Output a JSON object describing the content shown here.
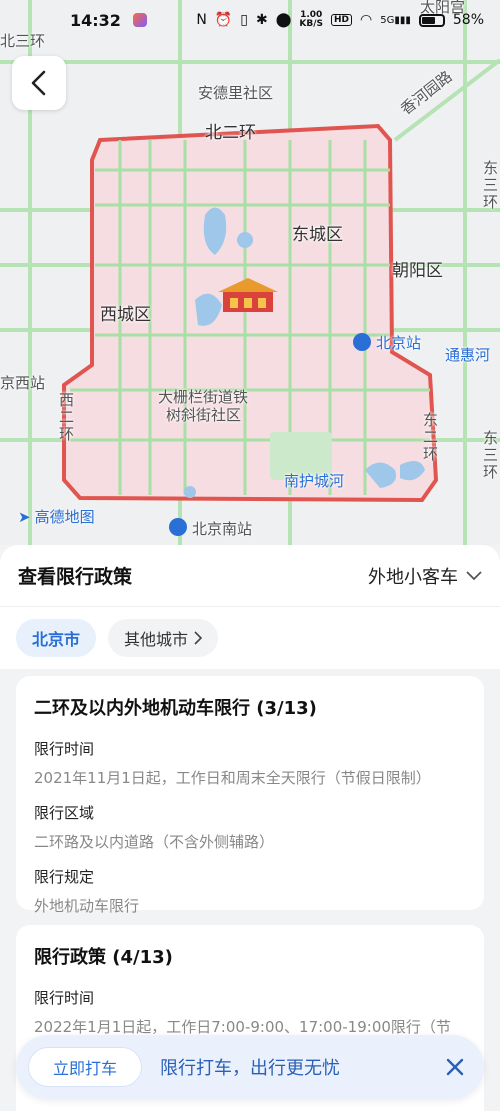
{
  "status_bar": {
    "time": "14:32",
    "speed_top": "1.00",
    "speed_bottom": "KB/S",
    "hd": "HD",
    "signal": "5G",
    "battery": "58%"
  },
  "map": {
    "labels": {
      "anding_community": "安德里社区",
      "north_second_ring": "北二环",
      "dongcheng": "东城区",
      "xicheng": "西城区",
      "chaoyang": "朝阳区",
      "beijing_station": "北京站",
      "dashilan": "大栅栏街道铁",
      "shuxie": "树斜街社区",
      "west_second_ring": "西二环",
      "east_second_ring": "东二环",
      "south_moat": "南护城河",
      "beijing_south": "北京南站",
      "north_third_ring": "北三环",
      "xiangheyuan": "香河园路",
      "dongzhimen_right": "东三环",
      "tonghui": "通惠河",
      "west_station": "京西站",
      "east_third_ring_right": "东三环",
      "taiyang": "太阳宫",
      "top_edge": "北二环"
    },
    "logo": "高德地图",
    "colors": {
      "region_fill": "#f6dde2",
      "region_border": "#e0554f",
      "road": "#a7dfa4",
      "water": "#9fc7ea"
    }
  },
  "sheet": {
    "title": "查看限行政策",
    "vehicle_type": "外地小客车",
    "tabs": [
      {
        "label": "北京市",
        "active": true
      },
      {
        "label": "其他城市",
        "active": false
      }
    ]
  },
  "card1": {
    "title": "二环及以内外地机动车限行 (3/13)",
    "time_label": "限行时间",
    "time_value": "2021年11月1日起，工作日和周末全天限行（节假日限制）",
    "area_label": "限行区域",
    "area_value": "二环路及以内道路（不含外侧辅路）",
    "rule_label": "限行规定",
    "rule_value": "外地机动车限行"
  },
  "card2": {
    "title": "限行政策 (4/13)",
    "time_label": "限行时间",
    "time_value": "2022年1月1日起，工作日7:00-9:00、17:00-19:00限行（节"
  },
  "banner": {
    "button": "立即打车",
    "slogan": "限行打车，出行更无忧"
  }
}
